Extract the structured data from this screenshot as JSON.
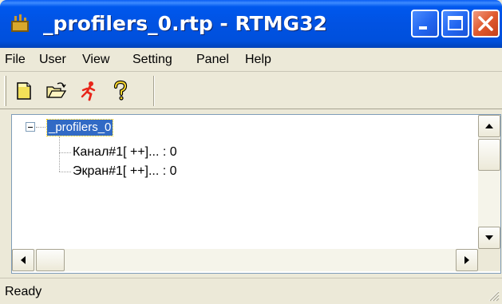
{
  "window": {
    "title": "_profilers_0.rtp - RTMG32",
    "title_color": "#ffffff",
    "titlebar_color": "#0054e3",
    "close_color": "#e05a2e"
  },
  "menu": {
    "items": [
      "File",
      "User",
      "View",
      "Setting",
      "Panel",
      "Help"
    ]
  },
  "toolbar": {
    "buttons": [
      {
        "icon": "new-document-icon"
      },
      {
        "icon": "open-folder-icon"
      },
      {
        "icon": "run-icon"
      },
      {
        "icon": "help-icon"
      }
    ]
  },
  "tree": {
    "root": {
      "label": "_profilers_0",
      "expanded": true,
      "selected": true
    },
    "children": [
      {
        "label": "Канал#1[ ++]... : 0"
      },
      {
        "label": "Экран#1[ ++]... : 0"
      }
    ],
    "selection_color": "#316ac5"
  },
  "status": {
    "text": "Ready"
  }
}
